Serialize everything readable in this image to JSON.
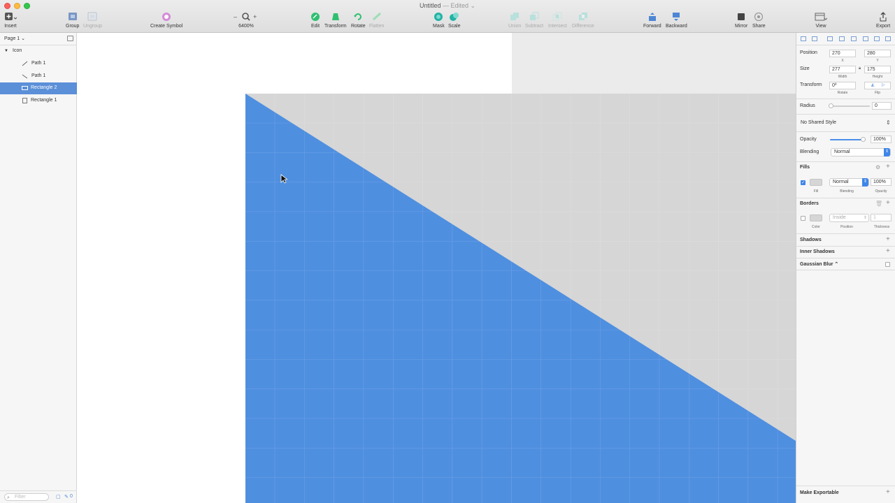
{
  "window": {
    "title": "Untitled",
    "status": "— Edited ⌄"
  },
  "toolbar": {
    "insert": "Insert",
    "group": "Group",
    "ungroup": "Ungroup",
    "create_symbol": "Create Symbol",
    "zoom_minus": "–",
    "zoom_plus": "+",
    "zoom_level": "6400%",
    "edit": "Edit",
    "transform": "Transform",
    "rotate": "Rotate",
    "flatten": "Flatten",
    "mask": "Mask",
    "scale": "Scale",
    "union": "Union",
    "subtract": "Subtract",
    "intersect": "Intersect",
    "difference": "Difference",
    "forward": "Forward",
    "backward": "Backward",
    "mirror": "Mirror",
    "share": "Share",
    "view": "View",
    "export": "Export"
  },
  "layers": {
    "page": "Page 1 ⌄",
    "group": "Icon",
    "items": [
      "Path 1",
      "Path 1",
      "Rectangle 2",
      "Rectangle 1"
    ],
    "filter_placeholder": "Filter",
    "footer_count": "0"
  },
  "inspector": {
    "position_label": "Position",
    "pos_x": "270",
    "pos_y": "280",
    "x_label": "X",
    "y_label": "Y",
    "size_label": "Size",
    "width": "277",
    "height": "175",
    "width_label": "Width",
    "height_label": "Height",
    "transform_label": "Transform",
    "rotate_value": "0º",
    "rotate_label": "Rotate",
    "flip_label": "Flip",
    "radius_label": "Radius",
    "radius_value": "0",
    "shared_style": "No Shared Style",
    "opacity_label": "Opacity",
    "opacity_value": "100%",
    "opacity_level": 1.0,
    "blending_label": "Blending",
    "blending_value": "Normal",
    "fills_title": "Fills",
    "fill_blending": "Normal",
    "fill_opacity": "100%",
    "fill_label": "Fill",
    "fill_blending_label": "Blending",
    "fill_opacity_label": "Opacity",
    "borders_title": "Borders",
    "border_position": "Inside",
    "border_thickness": "1",
    "color_label": "Color",
    "position_sub_label": "Position",
    "thickness_label": "Thickness",
    "shadows_title": "Shadows",
    "inner_shadows_title": "Inner Shadows",
    "gaussian_blur": "Gaussian Blur ⌃",
    "make_exportable": "Make Exportable"
  },
  "colors": {
    "shape_blue": "#4f8fe0",
    "shape_gray": "#d6d6d6",
    "selection": "#5b8fd8"
  }
}
